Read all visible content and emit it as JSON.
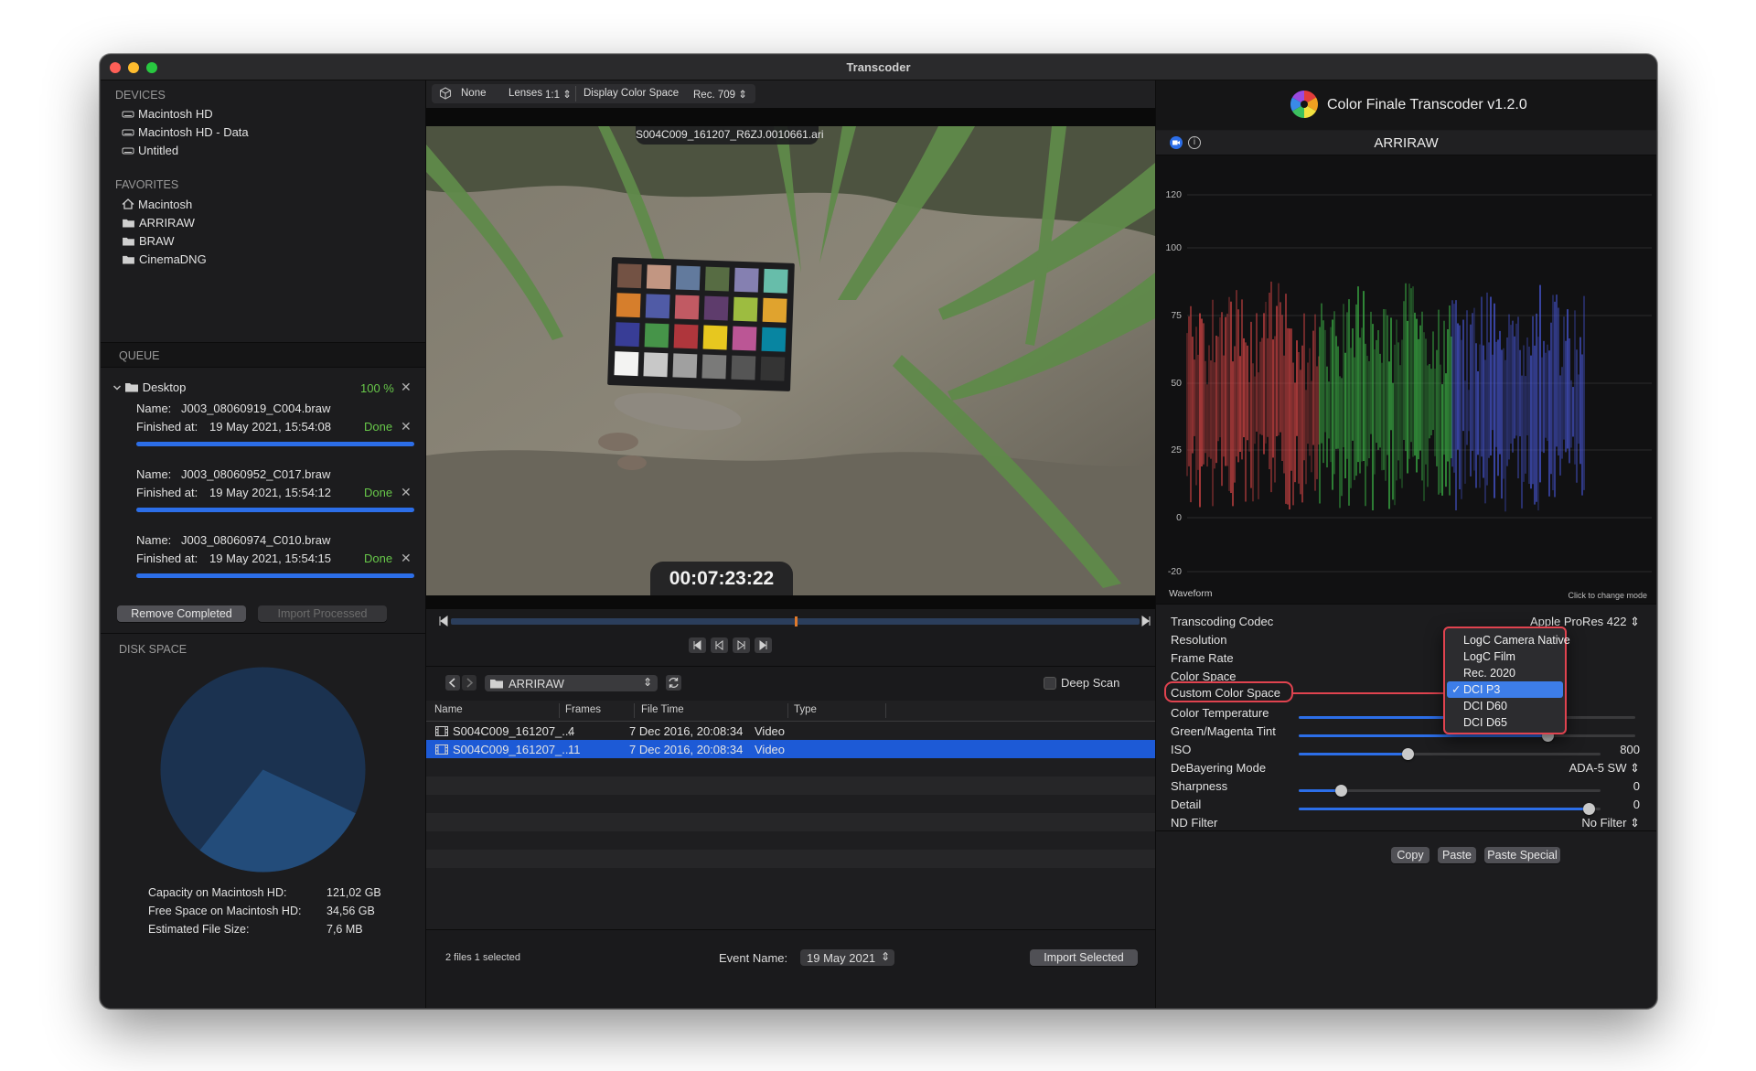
{
  "window": {
    "title": "Transcoder"
  },
  "sidebar": {
    "devices_header": "DEVICES",
    "devices": [
      "Macintosh HD",
      "Macintosh HD - Data",
      "Untitled"
    ],
    "favorites_header": "FAVORITES",
    "favorites": [
      {
        "label": "Macintosh",
        "icon": "home-icon"
      },
      {
        "label": "ARRIRAW",
        "icon": "folder-icon"
      },
      {
        "label": "BRAW",
        "icon": "folder-icon"
      },
      {
        "label": "CinemaDNG",
        "icon": "folder-icon"
      }
    ]
  },
  "queue": {
    "header": "QUEUE",
    "group_label": "Desktop",
    "group_progress": "100 %",
    "name_label": "Name:",
    "finished_label": "Finished at:",
    "items": [
      {
        "name": "J003_08060919_C004.braw",
        "finished": "19 May 2021, 15:54:08",
        "status": "Done",
        "progress": 1.0
      },
      {
        "name": "J003_08060952_C017.braw",
        "finished": "19 May 2021, 15:54:12",
        "status": "Done",
        "progress": 1.0
      },
      {
        "name": "J003_08060974_C010.braw",
        "finished": "19 May 2021, 15:54:15",
        "status": "Done",
        "progress": 1.0
      }
    ],
    "remove_completed": "Remove Completed",
    "import_processed": "Import Processed"
  },
  "disk": {
    "header": "DISK SPACE",
    "free_fraction": 0.2857,
    "capacity_label": "Capacity on Macintosh HD:",
    "capacity_value": "121,02 GB",
    "free_label": "Free Space on Macintosh HD:",
    "free_value": "34,56 GB",
    "est_label": "Estimated File Size:",
    "est_value": "7,6 MB",
    "colors": {
      "used": "#1b3250",
      "free": "#234c7a"
    }
  },
  "viewer": {
    "lut_value": "None",
    "lenses_label": "Lenses",
    "lenses_value": "1:1",
    "display_cs_label": "Display Color Space",
    "display_cs_value": "Rec. 709",
    "clip_name": "S004C009_161207_R6ZJ.0010661.ari",
    "timecode": "00:07:23:22",
    "playhead_fraction": 0.5
  },
  "browser": {
    "folder": "ARRIRAW",
    "deep_scan_label": "Deep Scan",
    "columns": [
      "Name",
      "Frames",
      "File Time",
      "Type"
    ],
    "rows": [
      {
        "name": "S004C009_161207_...",
        "frames": "4",
        "time": "7 Dec 2016, 20:08:34",
        "type": "Video",
        "selected": false
      },
      {
        "name": "S004C009_161207_...",
        "frames": "11",
        "time": "7 Dec 2016, 20:08:34",
        "type": "Video",
        "selected": true
      }
    ],
    "selection_status": "2 files 1 selected",
    "event_label": "Event Name:",
    "event_value": "19 May 2021",
    "import_selected": "Import Selected"
  },
  "inspector": {
    "app_title": "Color Finale Transcoder v1.2.0",
    "format": "ARRIRAW",
    "waveform": {
      "label": "Waveform",
      "hint": "Click to change mode",
      "ticks": [
        "120",
        "100",
        "75",
        "50",
        "25",
        "0",
        "-20"
      ],
      "colors": {
        "red": "#e04848",
        "green": "#3fc04a",
        "blue": "#4a5ae0"
      }
    },
    "properties": {
      "codec_label": "Transcoding Codec",
      "codec_value": "Apple ProRes 422",
      "resolution_label": "Resolution",
      "framerate_label": "Frame Rate",
      "colorspace_label": "Color Space",
      "custom_cs_label": "Custom Color Space",
      "temp_label": "Color Temperature",
      "temp_level": 0.59,
      "tint_label": "Green/Magenta Tint",
      "tint_level": 0.74,
      "iso_label": "ISO",
      "iso_value": "800",
      "iso_level": 0.36,
      "debayer_label": "DeBayering Mode",
      "debayer_value": "ADA-5 SW",
      "sharp_label": "Sharpness",
      "sharp_value": "0",
      "sharp_level": 0.14,
      "detail_label": "Detail",
      "detail_value": "0",
      "detail_level": 0.96,
      "nd_label": "ND Filter",
      "nd_value": "No Filter"
    },
    "colorspace_menu": {
      "options": [
        "LogC Camera Native",
        "LogC Film",
        "Rec. 2020",
        "DCI P3",
        "DCI D60",
        "DCI D65"
      ],
      "selected": "DCI P3"
    },
    "buttons": {
      "copy": "Copy",
      "paste": "Paste",
      "paste_special": "Paste Special"
    }
  }
}
